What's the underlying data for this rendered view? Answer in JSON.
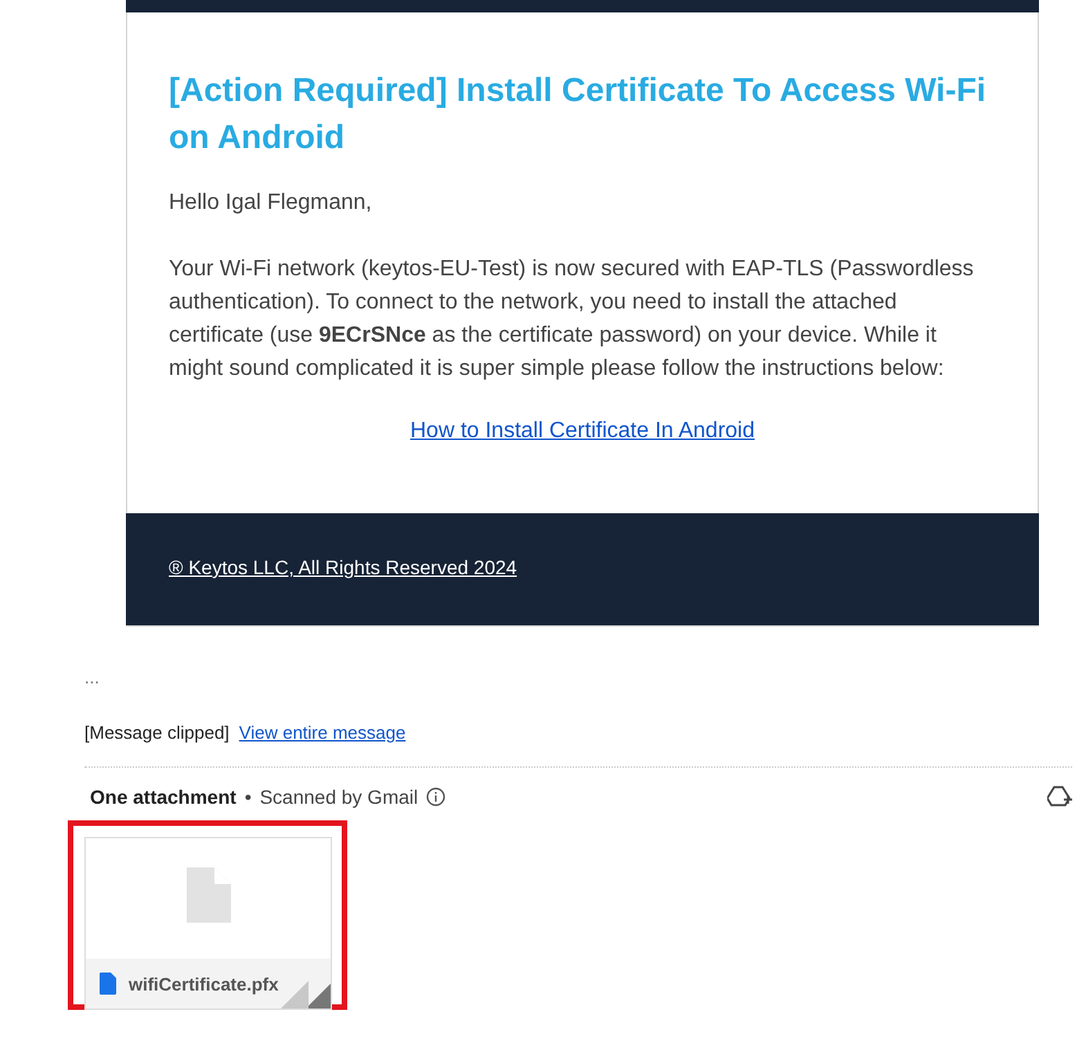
{
  "email": {
    "title": "[Action Required] Install Certificate To Access Wi-Fi on Android",
    "greeting": "Hello Igal Flegmann,",
    "paragraph": "Your Wi-Fi network (keytos-EU-Test) is now secured with EAP-TLS (Passwordless authentication). To connect to the network, you need to install the attached certificate (use **9ECrSNce** as the certificate password) on your device. While it might sound complicated it is super simple please follow the instructions below:",
    "link": "How to Install Certificate In Android",
    "footer": "® Keytos LLC, All Rights Reserved 2024"
  },
  "trimmed": "...",
  "clipped": {
    "label": "[Message clipped]",
    "link": "View entire message"
  },
  "attachments": {
    "heading": "One attachment",
    "separator": "•",
    "scanned": "Scanned by Gmail",
    "files": [
      {
        "name": "wifiCertificate.pfx",
        "highlighted": true
      }
    ]
  }
}
